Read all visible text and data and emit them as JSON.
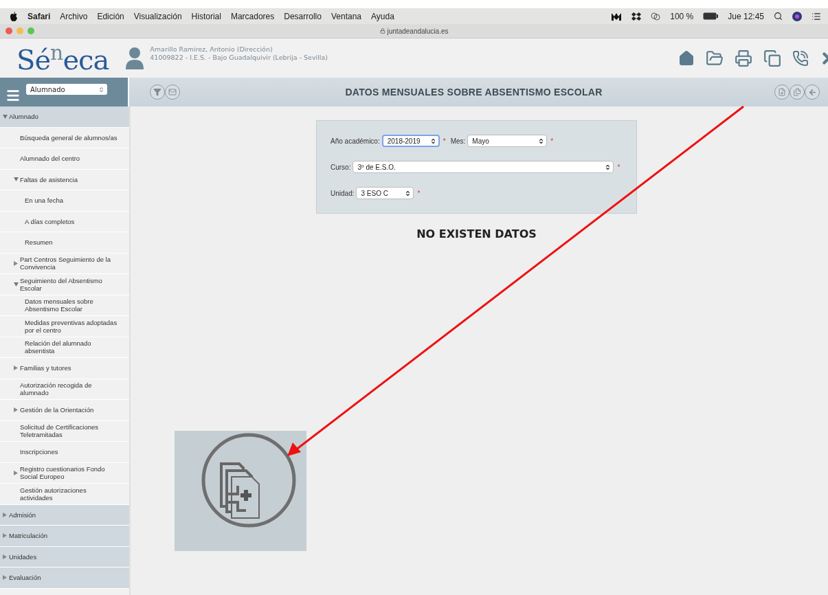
{
  "menu_bar": {
    "app": "Safari",
    "menus": [
      "Archivo",
      "Edición",
      "Visualización",
      "Historial",
      "Marcadores",
      "Desarrollo",
      "Ventana",
      "Ayuda"
    ],
    "battery": "100 %",
    "clock": "Jue 12:45"
  },
  "browser": {
    "url": "juntadeandalucia.es"
  },
  "header": {
    "logo": "Sé$^{n}$eca",
    "user_name": "Amarillo Ramirez, Antonio (Dirección)",
    "user_center": "41009822 - I.E.S. - Bajo Guadalquivir (Lebrija - Sevilla)"
  },
  "toolbar": {
    "section_select": "Alumnado",
    "title": "DATOS MENSUALES SOBRE ABSENTISMO ESCOLAR"
  },
  "sidebar": {
    "items": [
      {
        "label": "Alumnado",
        "expanded": true,
        "children": [
          {
            "label": "Búsqueda general de alumnos/as"
          },
          {
            "label": "Alumnado del centro"
          },
          {
            "label": "Faltas de asistencia",
            "expanded": true,
            "children": [
              {
                "label": "En una fecha"
              },
              {
                "label": "A días completos"
              },
              {
                "label": "Resumen"
              }
            ]
          },
          {
            "label": "Part Centros Seguimiento de la Convivencia",
            "expanded": false
          },
          {
            "label": "Seguimiento del Absentismo Escolar",
            "expanded": true,
            "children": [
              {
                "label": "Datos mensuales sobre Absentismo Escolar"
              },
              {
                "label": "Medidas preventivas adoptadas por el centro"
              },
              {
                "label": "Relación del alumnado absentista"
              }
            ]
          },
          {
            "label": "Familias y tutores",
            "expanded": false
          },
          {
            "label": "Autorización recogida de alumnado"
          },
          {
            "label": "Gestión de la Orientación",
            "expanded": false
          },
          {
            "label": "Solicitud de Certificaciones Teletramitadas"
          },
          {
            "label": "Inscripciones"
          },
          {
            "label": "Registro cuestionarios Fondo Social Europeo",
            "expanded": false
          },
          {
            "label": "Gestión autorizaciones actividades"
          }
        ]
      },
      {
        "label": "Admisión",
        "expanded": false
      },
      {
        "label": "Matriculación",
        "expanded": false
      },
      {
        "label": "Unidades",
        "expanded": false
      },
      {
        "label": "Evaluación",
        "expanded": false
      }
    ]
  },
  "form": {
    "rows": [
      [
        {
          "label": "Año académico:",
          "value": "2018-2019",
          "focused": true,
          "mark": "*"
        },
        {
          "label": "Mes:",
          "value": "Mayo",
          "focused": false,
          "mark": "*"
        }
      ],
      [
        {
          "label": "Curso:",
          "value": "3º de E.S.O.",
          "focused": false,
          "mark": "*"
        }
      ],
      [
        {
          "label": "Unidad:",
          "value": "3 ESO C",
          "focused": false,
          "mark": "*"
        }
      ]
    ]
  },
  "message": "NO EXISTEN DATOS"
}
